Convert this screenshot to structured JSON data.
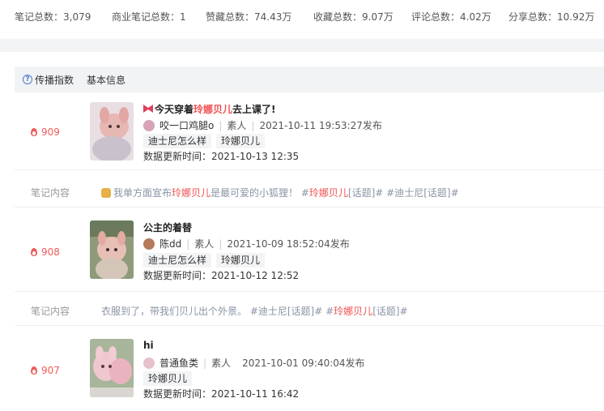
{
  "stats": [
    {
      "label": "笔记总数：3,079"
    },
    {
      "label": "商业笔记总数：1"
    },
    {
      "label": "赞藏总数：74.43万"
    },
    {
      "label": "收藏总数：9.07万"
    },
    {
      "label": "评论总数：4.02万"
    },
    {
      "label": "分享总数：10.92万"
    }
  ],
  "header": {
    "help_label": "传播指数",
    "info_label": "基本信息"
  },
  "notes": [
    {
      "rank": "909",
      "title_pre": "今天穿着",
      "title_hl": "玲娜贝儿",
      "title_post": "去上课了!",
      "author": "咬一口鸡腿o",
      "role": "素人",
      "published": "2021-10-11 19:53:27发布",
      "tags": [
        "迪士尼怎么样",
        "玲娜贝儿"
      ],
      "updated": "数据更新时间：2021-10-13 12:35",
      "content_label": "笔记内容",
      "content_pre": "我单方面宣布",
      "content_hl": "玲娜贝儿",
      "content_mid": "是最可爱的小狐狸！ #",
      "content_hl2": "玲娜贝儿",
      "content_post": "[话题]# #迪士尼[话题]#"
    },
    {
      "rank": "908",
      "title": "公主的着替",
      "author": "陈dd",
      "role": "素人",
      "published": "2021-10-09 18:52:04发布",
      "tags": [
        "迪士尼怎么样",
        "玲娜贝儿"
      ],
      "updated": "数据更新时间：2021-10-12 12:52",
      "content_label": "笔记内容",
      "content_pre": "衣服到了，带我们贝儿出个外景。 #迪士尼[话题]# #",
      "content_hl": "玲娜贝儿",
      "content_post": "[话题]#"
    },
    {
      "rank": "907",
      "title": "hi",
      "author": "普通鱼类",
      "role": "素人",
      "published": "2021-10-01 09:40:04发布",
      "tags": [
        "玲娜贝儿"
      ],
      "updated": "数据更新时间：2021-10-11 16:42"
    }
  ],
  "colors": {
    "accent": "#f05050",
    "muted": "#8a94a6",
    "band": "#f2f3f5"
  }
}
